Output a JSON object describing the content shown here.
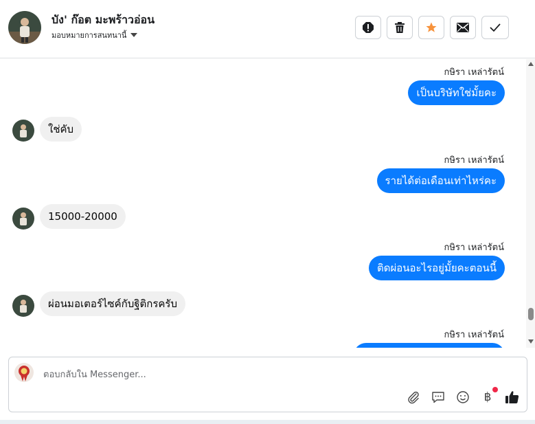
{
  "header": {
    "contact_name": "บัง' ก๊อต มะพร้าวอ่อน",
    "assign_label": "มอบหมายการสนทนานี้",
    "actions": [
      "report-icon",
      "trash-icon",
      "star-icon",
      "mail-icon",
      "check-icon"
    ],
    "star_color": "#f7923b"
  },
  "messages": {
    "m1": {
      "sender": "กษิรา เหล่ารัตน์",
      "text": "เป็นบริษัทใช่มั้ยคะ"
    },
    "m2": {
      "text": "ใช่คับ"
    },
    "m3": {
      "sender": "กษิรา เหล่ารัตน์",
      "text": "รายได้ต่อเดือนเท่าไหร่คะ"
    },
    "m4": {
      "text": "15000-20000"
    },
    "m5": {
      "sender": "กษิรา เหล่ารัตน์",
      "text": "ติดผ่อนอะไรอยู่มั้ยคะตอนนี้"
    },
    "m6": {
      "text": "ผ่อนมอเตอร์ไซค์กับฐิติกรครับ"
    },
    "m7": {
      "sender": "กษิรา เหล่ารัตน์"
    }
  },
  "composer": {
    "placeholder": "ตอบกลับใน Messenger...",
    "value": "",
    "tools": [
      "attach-icon",
      "saved-replies-icon",
      "emoji-icon",
      "payment-baht-icon",
      "thumbs-up-icon"
    ],
    "baht_symbol": "฿"
  },
  "colors": {
    "outgoing_bubble": "#0a7cff",
    "incoming_bubble": "#f0f0f0",
    "notification_dot": "#f02849"
  }
}
